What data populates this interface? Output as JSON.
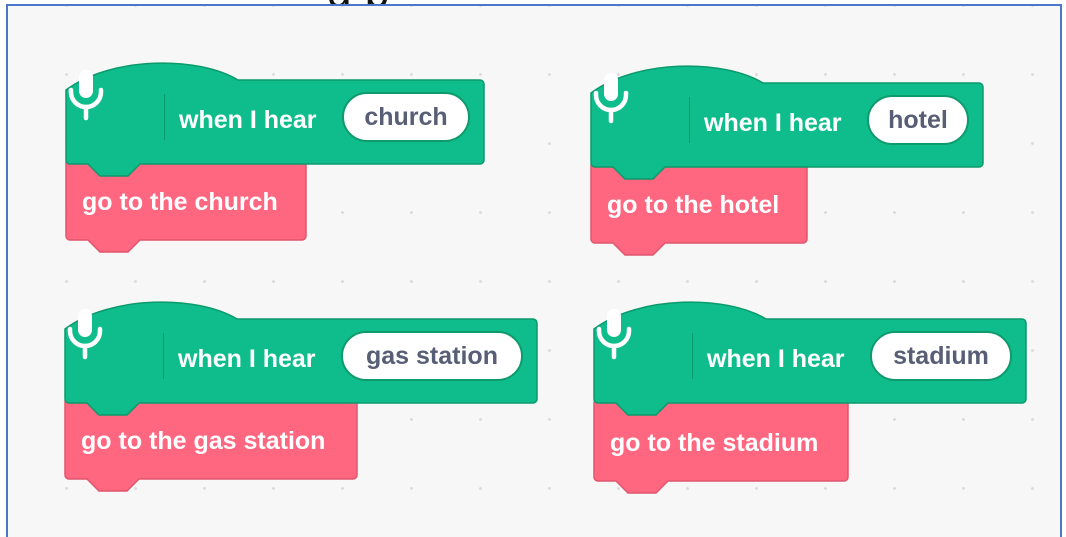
{
  "header": {
    "title_fragment": "g p"
  },
  "colors": {
    "hat_fill": "#0fbd8c",
    "hat_border": "#0b9a6c",
    "command_fill": "#ff6680",
    "command_border": "#e0566d",
    "pill_text": "#575e75",
    "canvas_background": "#f7f7f7",
    "frame_border": "#4a77c9"
  },
  "scripts": [
    {
      "event_icon": "microphone-icon",
      "event_label": "when I hear",
      "phrase": "church",
      "action_label": "go to the church"
    },
    {
      "event_icon": "microphone-icon",
      "event_label": "when I hear",
      "phrase": "hotel",
      "action_label": "go to the hotel"
    },
    {
      "event_icon": "microphone-icon",
      "event_label": "when I hear",
      "phrase": "gas station",
      "action_label": "go to the gas station"
    },
    {
      "event_icon": "microphone-icon",
      "event_label": "when I hear",
      "phrase": "stadium",
      "action_label": "go to the stadium"
    }
  ]
}
